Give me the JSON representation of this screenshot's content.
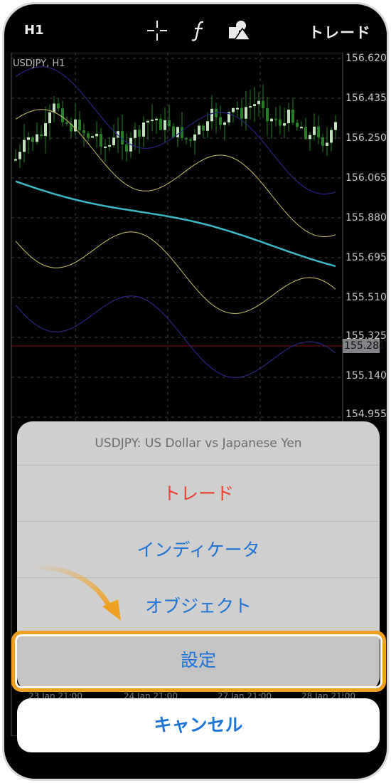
{
  "toolbar": {
    "period": "H1",
    "trade_label": "トレード",
    "icons": [
      "crosshair-icon",
      "function-icon",
      "objects-icon"
    ]
  },
  "chart": {
    "symbol_label": "USDJPY, H1",
    "price_ticks": [
      "156.620",
      "156.435",
      "156.250",
      "156.065",
      "155.880",
      "155.695",
      "155.510",
      "155.325",
      "155.140",
      "154.955"
    ],
    "partial_ticks": [
      "0",
      "5",
      "0",
      "0"
    ],
    "current_price": "155.281",
    "time_ticks": [
      "23 Jan 21:00",
      "24 Jan 21:00",
      "27 Jan 21:00",
      "28 Jan 21:00"
    ],
    "colors": {
      "background": "#000000",
      "bull_candle": "#d4f5cf",
      "bear_candle": "#2a8a2a",
      "moving_average": "#40c9d8",
      "envelope": "#d8d26a",
      "bollinger": "#2a2a8a",
      "current_price_line": "#8a1010"
    }
  },
  "sheet": {
    "title": "USDJPY: US Dollar vs Japanese Yen",
    "items": {
      "trade": "トレード",
      "indicators": "インディケータ",
      "objects": "オブジェクト",
      "settings": "設定"
    },
    "cancel": "キャンセル",
    "colors": {
      "destructive": "#e8432f",
      "action": "#1c74d6",
      "highlight": "#f0a020"
    }
  }
}
